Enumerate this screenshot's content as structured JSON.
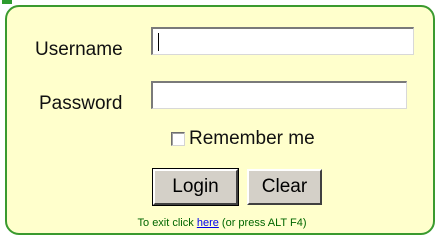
{
  "form": {
    "username_label": "Username",
    "username_value": "",
    "password_label": "Password",
    "password_value": "",
    "remember_label": "Remember me",
    "remember_checked": false,
    "login_button": "Login",
    "clear_button": "Clear",
    "exit_prefix": "To exit click",
    "exit_link": "here",
    "exit_suffix": "(or press ALT F4)"
  },
  "colors": {
    "panel_background": "#ffffcc",
    "panel_border": "#3a9a2e",
    "button_face": "#d4d0c8",
    "exit_text": "#006600",
    "link": "#0000ee"
  }
}
